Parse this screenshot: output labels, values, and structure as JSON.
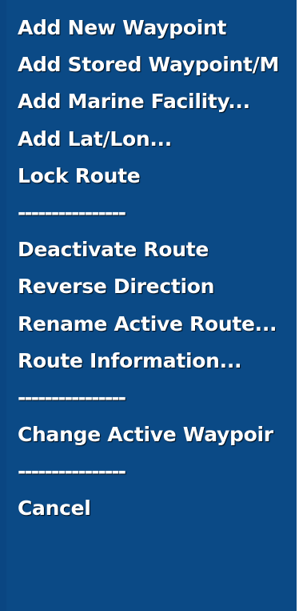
{
  "menu": {
    "items": [
      {
        "label": "Add New Waypoint",
        "type": "item"
      },
      {
        "label": "Add Stored Waypoint/M",
        "type": "item"
      },
      {
        "label": "Add Marine Facility...",
        "type": "item"
      },
      {
        "label": "Add Lat/Lon...",
        "type": "item"
      },
      {
        "label": "Lock Route",
        "type": "item"
      },
      {
        "label": "----------------",
        "type": "separator"
      },
      {
        "label": "Deactivate Route",
        "type": "item"
      },
      {
        "label": "Reverse Direction",
        "type": "item"
      },
      {
        "label": "Rename Active Route...",
        "type": "item"
      },
      {
        "label": "Route Information...",
        "type": "item"
      },
      {
        "label": "----------------",
        "type": "separator"
      },
      {
        "label": "Change Active Waypoir",
        "type": "item"
      },
      {
        "label": "----------------",
        "type": "separator"
      },
      {
        "label": "Cancel",
        "type": "item"
      }
    ]
  },
  "colors": {
    "background": "#0b4a86",
    "text": "#ffffff"
  }
}
